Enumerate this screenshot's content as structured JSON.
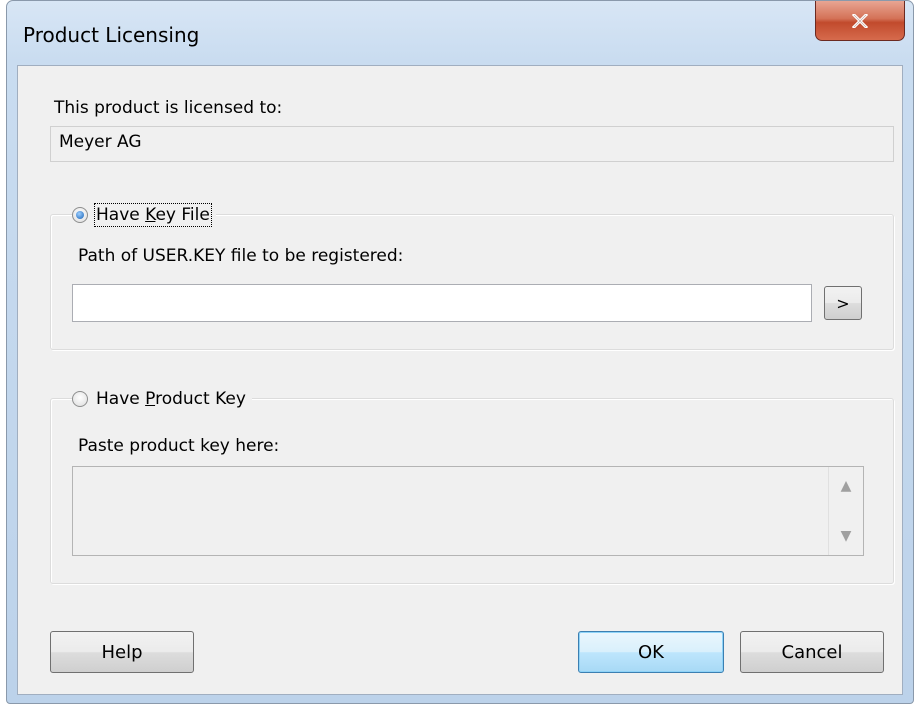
{
  "window": {
    "title": "Product Licensing",
    "close_glyph": "x"
  },
  "license": {
    "label": "This product is licensed to:",
    "value": "Meyer AG"
  },
  "key_file": {
    "option_pre": "Have ",
    "option_mnemonic": "K",
    "option_post": "ey File",
    "checked": true,
    "path_label": "Path of USER.KEY file to be registered:",
    "path_value": "",
    "browse_label": ">"
  },
  "product_key": {
    "option_pre": "Have ",
    "option_mnemonic": "P",
    "option_post": "roduct Key",
    "checked": false,
    "paste_label": "Paste product key here:",
    "value": "",
    "scroll_up": "▲",
    "scroll_down": "▼"
  },
  "buttons": {
    "help": "Help",
    "ok": "OK",
    "cancel": "Cancel"
  },
  "colors": {
    "client_bg": "#f0f0f0",
    "close_button": "#c14a2c",
    "default_button_border": "#3c7fb1"
  }
}
